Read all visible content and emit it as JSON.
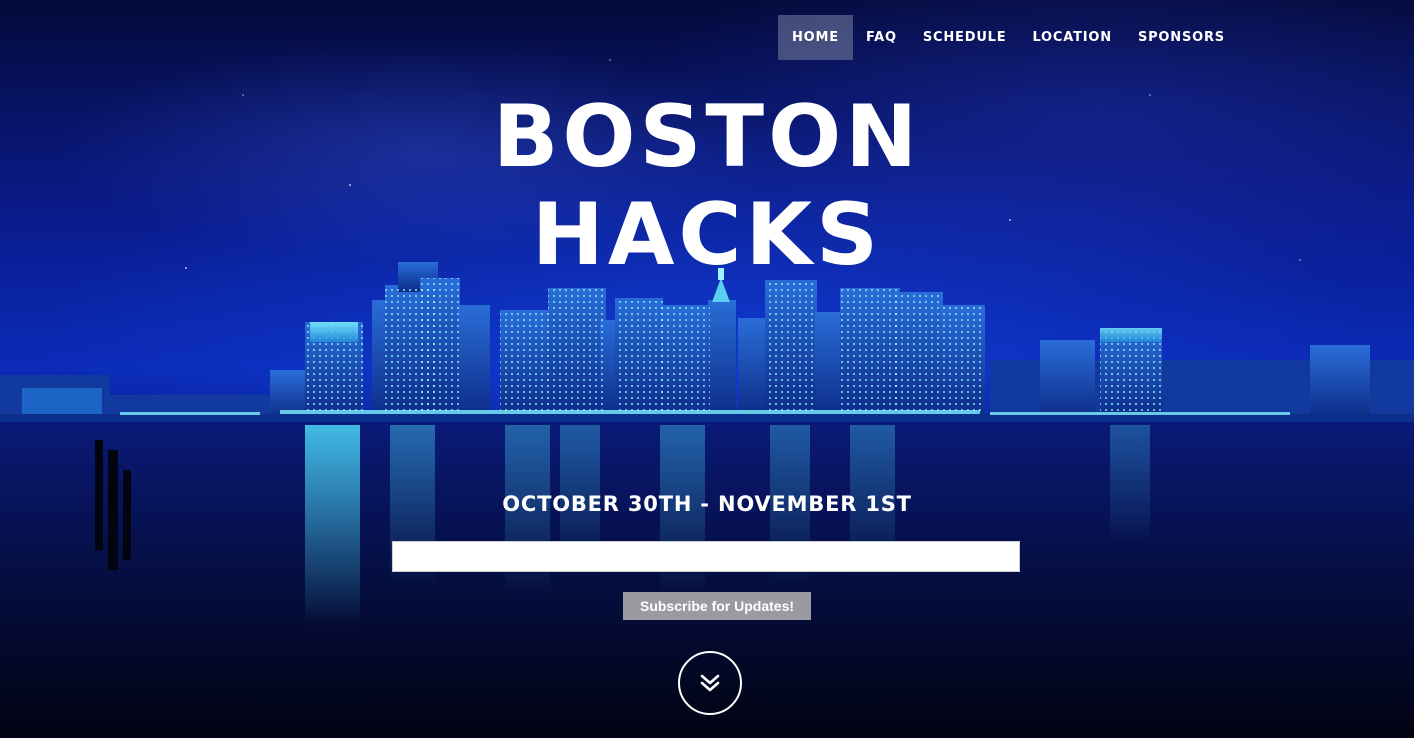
{
  "nav": {
    "items": [
      {
        "label": "HOME",
        "active": true
      },
      {
        "label": "FAQ",
        "active": false
      },
      {
        "label": "SCHEDULE",
        "active": false
      },
      {
        "label": "LOCATION",
        "active": false
      },
      {
        "label": "SPONSORS",
        "active": false
      }
    ]
  },
  "hero": {
    "title_line1": "BOSTON",
    "title_line2": "HACKS",
    "dates": "OCTOBER 30TH - NOVEMBER 1ST",
    "background": "Boston skyline at night over the harbor"
  },
  "subscribe": {
    "email_value": "",
    "email_placeholder": "",
    "button_label": "Subscribe for Updates!"
  },
  "scroll": {
    "icon": "double-chevron-down-icon"
  },
  "colors": {
    "nav_active_bg": "#6f7596",
    "text": "#ffffff",
    "button_bg": "#9a9aa0",
    "sky": "#0b2bb8",
    "city_lights": "#3ee0ff"
  }
}
